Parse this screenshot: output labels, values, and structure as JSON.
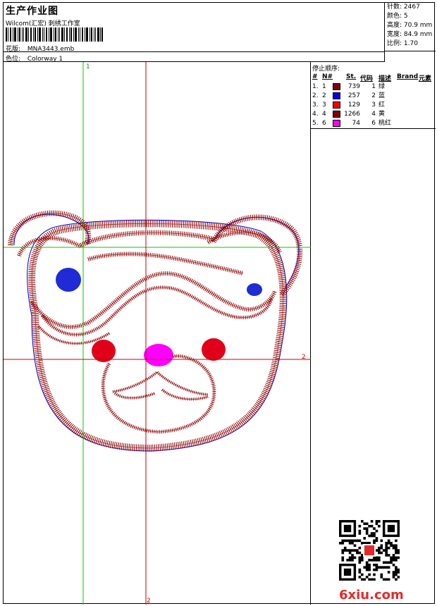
{
  "header": {
    "title": "生产作业图",
    "studio": "Wilcom(汇宏) 刺绣工作室",
    "design_label": "花版:",
    "design_value": "MNA3443.emb",
    "colorway_label": "色位:",
    "colorway_value": "Colorway 1"
  },
  "stats": {
    "stitches": "针数: 2467",
    "colors": "颜色: 5",
    "height": "高度: 70.9 mm",
    "width": "宽度: 84.9 mm",
    "scale": "比例: 1.70"
  },
  "guides": {
    "v_green": "1",
    "h_red": "2",
    "v_red": "2"
  },
  "sequence": {
    "title": "停止顺序:",
    "headers": [
      "#",
      "N#",
      "St.",
      "代码",
      "描述",
      "Brand",
      "元素"
    ],
    "rows": [
      {
        "idx": "1.",
        "n": "1",
        "color": "#800000",
        "st": "739",
        "code": "1",
        "desc": "绿"
      },
      {
        "idx": "2.",
        "n": "2",
        "color": "#0000ff",
        "st": "257",
        "code": "2",
        "desc": "蓝"
      },
      {
        "idx": "3.",
        "n": "3",
        "color": "#ff0000",
        "st": "129",
        "code": "3",
        "desc": "红"
      },
      {
        "idx": "4.",
        "n": "4",
        "color": "#800000",
        "st": "1266",
        "code": "4",
        "desc": "黄"
      },
      {
        "idx": "5.",
        "n": "6",
        "color": "#ff00ff",
        "st": "74",
        "code": "6",
        "desc": "桃红"
      }
    ]
  },
  "watermark": "6xiu.com",
  "colors": {
    "stitch": "#8b0000",
    "outline": "#0000cc",
    "guide_green": "#00cc00",
    "guide_red": "#cc0000",
    "eye": "#1f2bd6",
    "cheek": "#e0001a",
    "nose": "#ff00ff"
  }
}
